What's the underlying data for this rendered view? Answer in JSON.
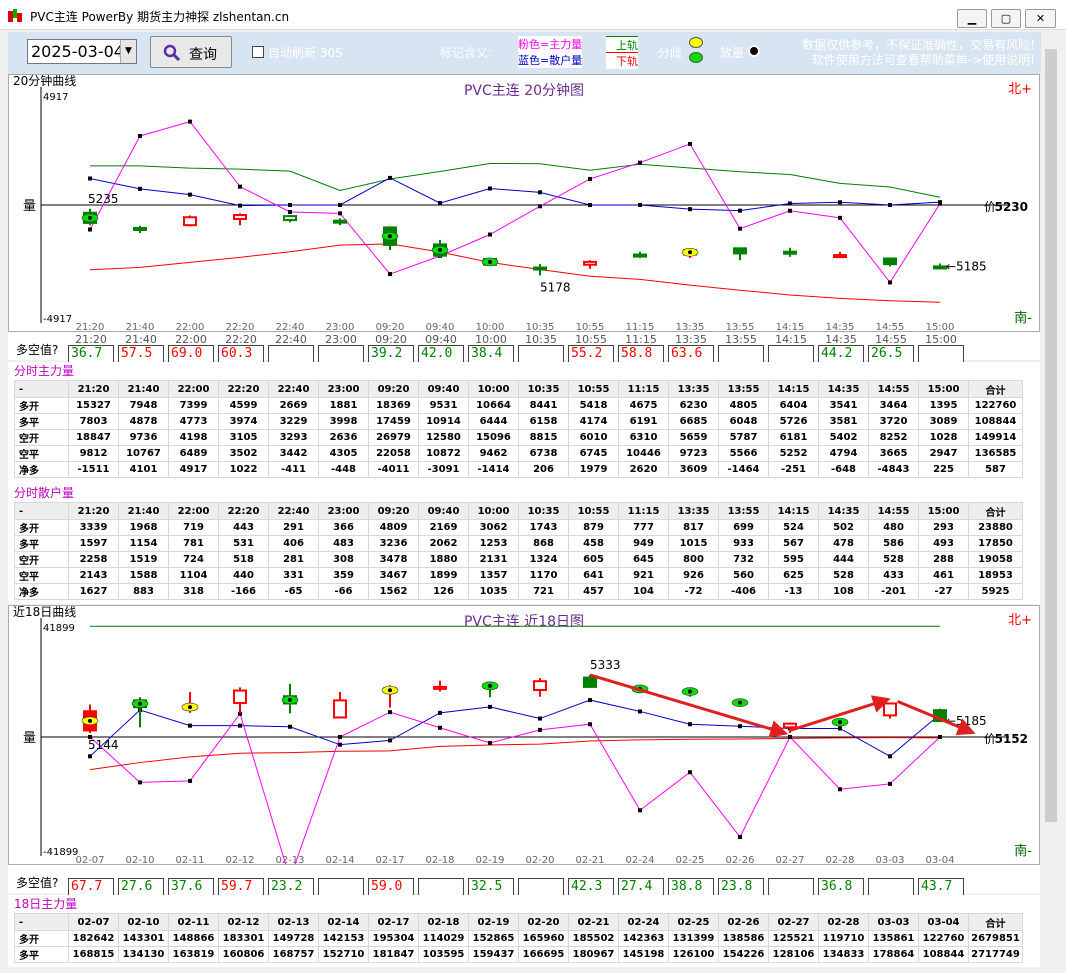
{
  "window": {
    "title": "PVC主连  PowerBy 期货主力神探 zlshentan.cn"
  },
  "toolbar": {
    "date": "2025-03-04",
    "query": "查询",
    "auto_refresh": "自动刷新 30S",
    "legend_title": "标记含义:",
    "legend_pink": "粉色=主力量",
    "legend_blue": "蓝色=散户量",
    "up_rail": "上轨",
    "down_rail": "下轨",
    "diverge": "分歧",
    "volume": "放量",
    "disclaimer1": "数据仅供参考，不保证准确性，交易有风险!",
    "disclaimer2": "软件使用方法可查看帮助菜单->使用说明!"
  },
  "labels": {
    "multi_short": "多空值?"
  },
  "colors": {
    "pink": "#ff00ff",
    "blue": "#0000d0",
    "green": "#008000",
    "red": "#ff0000",
    "up": "#ff0000",
    "down": "#008000"
  },
  "chart_data": [
    {
      "type": "candlestick",
      "section_label": "20分钟曲线",
      "title": "PVC主连 20分钟图",
      "ylabel": "量",
      "top_value": "4917",
      "bottom_value": "-4917",
      "ylim": [
        -4917,
        4917
      ],
      "north": "北+",
      "south": "南-",
      "price_label": "价",
      "price_value": "5230",
      "high_label": "5235",
      "low_label": "5178",
      "last_label": "←5185",
      "categories": [
        "21:20",
        "21:40",
        "22:00",
        "22:20",
        "22:40",
        "23:00",
        "09:20",
        "09:40",
        "10:00",
        "10:35",
        "10:55",
        "11:15",
        "13:35",
        "13:55",
        "14:15",
        "14:35",
        "14:55",
        "15:00"
      ],
      "candles": [
        {
          "o": -0.28,
          "c": 0.08,
          "h": 0.22,
          "l": -0.36,
          "d": "down"
        },
        {
          "o": -0.46,
          "c": -0.46,
          "h": -0.38,
          "l": -0.64,
          "d": "down"
        },
        {
          "o": -0.36,
          "c": -0.08,
          "h": -0.02,
          "l": -0.4,
          "d": "up"
        },
        {
          "o": -0.14,
          "c": 0.0,
          "h": 0.06,
          "l": -0.36,
          "d": "up"
        },
        {
          "o": -0.18,
          "c": -0.04,
          "h": 0.0,
          "l": -0.26,
          "d": "down"
        },
        {
          "o": -0.2,
          "c": -0.24,
          "h": -0.12,
          "l": -0.36,
          "d": "down"
        },
        {
          "o": -0.44,
          "c": -1.06,
          "h": -0.4,
          "l": -1.24,
          "d": "down"
        },
        {
          "o": -1.04,
          "c": -1.44,
          "h": -0.88,
          "l": -1.52,
          "d": "down"
        },
        {
          "o": -1.56,
          "c": -1.76,
          "h": -1.52,
          "l": -1.8,
          "d": "down"
        },
        {
          "o": -1.86,
          "c": -1.86,
          "h": -1.74,
          "l": -2.14,
          "d": "down"
        },
        {
          "o": -1.76,
          "c": -1.66,
          "h": -1.6,
          "l": -1.9,
          "d": "up"
        },
        {
          "o": -1.4,
          "c": -1.4,
          "h": -1.3,
          "l": -1.52,
          "d": "down"
        },
        {
          "o": -1.24,
          "c": -1.4,
          "h": -1.2,
          "l": -1.52,
          "d": "up"
        },
        {
          "o": -1.36,
          "c": -1.18,
          "h": -1.18,
          "l": -1.6,
          "d": "down"
        },
        {
          "o": -1.3,
          "c": -1.36,
          "h": -1.16,
          "l": -1.48,
          "d": "down"
        },
        {
          "o": -1.42,
          "c": -1.42,
          "h": -1.3,
          "l": -1.52,
          "d": "up"
        },
        {
          "o": -1.74,
          "c": -1.54,
          "h": -1.5,
          "l": -1.82,
          "d": "down"
        },
        {
          "o": -1.82,
          "c": -1.82,
          "h": -1.72,
          "l": -1.92,
          "d": "down"
        }
      ],
      "pink": [
        -1022,
        2876,
        3474,
        765,
        -290,
        -348,
        -2879,
        -2124,
        -1230,
        -54,
        1085,
        1763,
        2544,
        -987,
        -241,
        -536,
        -3226,
        59
      ],
      "blue": [
        1105,
        672,
        432,
        -25,
        0,
        0,
        1129,
        80,
        687,
        528,
        0,
        0,
        -174,
        -236,
        62,
        114,
        0,
        118
      ],
      "green": [
        1630,
        1630,
        1536,
        1493,
        1410,
        607,
        1082,
        1395,
        1731,
        1720,
        1447,
        1697,
        1542,
        1386,
        1272,
        901,
        749,
        325
      ],
      "red": [
        -2700,
        -2600,
        -2390,
        -2180,
        -1950,
        -1670,
        -1620,
        -1960,
        -2390,
        -2690,
        -2970,
        -3100,
        -3340,
        -3550,
        -3750,
        -3890,
        -3990,
        -4050
      ],
      "multi_short": [
        "36.7",
        "57.5",
        "69.0",
        "60.3",
        "",
        "",
        "39.2",
        "42.0",
        "38.4",
        "",
        "55.2",
        "58.8",
        "63.6",
        "",
        "",
        "44.2",
        "26.5",
        ""
      ],
      "multi_short_color": [
        "g",
        "r",
        "r",
        "r",
        "",
        "",
        "g",
        "g",
        "g",
        "",
        "r",
        "r",
        "r",
        "",
        "",
        "g",
        "g",
        ""
      ],
      "diverge_marks": [
        0,
        6,
        7,
        8,
        12
      ],
      "volume_marks": [
        6,
        7,
        8
      ]
    },
    {
      "type": "candlestick",
      "section_label": "近18日曲线",
      "title": "PVC主连 近18日图",
      "ylabel": "量",
      "top_value": "41899",
      "bottom_value": "-41899",
      "ylim": [
        -41899,
        41899
      ],
      "north": "北+",
      "south": "南-",
      "price_label": "价",
      "price_value": "5152",
      "high_label": "5333",
      "low_label": "5144",
      "last_label": "←5185",
      "categories": [
        "02-07",
        "02-10",
        "02-11",
        "02-12",
        "02-13",
        "02-14",
        "02-17",
        "02-18",
        "02-19",
        "02-20",
        "02-21",
        "02-24",
        "02-25",
        "02-26",
        "02-27",
        "02-28",
        "03-03",
        "03-04"
      ],
      "candles": [
        {
          "o": 0.1,
          "c": 0.84,
          "h": 1.1,
          "l": 0.0,
          "d": "up"
        },
        {
          "o": 1.0,
          "c": 1.26,
          "h": 1.38,
          "l": 0.22,
          "d": "down"
        },
        {
          "o": 1.0,
          "c": 1.0,
          "h": 1.58,
          "l": 0.78,
          "d": "up"
        },
        {
          "o": 1.16,
          "c": 1.64,
          "h": 1.76,
          "l": 0.76,
          "d": "up"
        },
        {
          "o": 1.42,
          "c": 1.14,
          "h": 1.9,
          "l": 0.76,
          "d": "down"
        },
        {
          "o": 0.6,
          "c": 1.26,
          "h": 1.58,
          "l": 0.6,
          "d": "up"
        },
        {
          "o": 1.58,
          "c": 1.72,
          "h": 1.84,
          "l": 0.98,
          "d": "up"
        },
        {
          "o": 1.78,
          "c": 1.78,
          "h": 2.02,
          "l": 1.6,
          "d": "up"
        },
        {
          "o": 1.82,
          "c": 1.82,
          "h": 1.88,
          "l": 1.38,
          "d": "down"
        },
        {
          "o": 1.66,
          "c": 2.0,
          "h": 2.12,
          "l": 1.4,
          "d": "up"
        },
        {
          "o": 1.78,
          "c": 2.14,
          "h": 2.24,
          "l": 1.78,
          "d": "down"
        },
        {
          "o": 1.7,
          "c": 1.7,
          "h": 1.78,
          "l": 1.54,
          "d": "down"
        },
        {
          "o": 1.54,
          "c": 1.66,
          "h": 1.7,
          "l": 1.4,
          "d": "down"
        },
        {
          "o": 1.2,
          "c": 1.14,
          "h": 1.32,
          "l": 1.04,
          "d": "down"
        },
        {
          "o": 0.22,
          "c": 0.36,
          "h": 0.4,
          "l": 0.0,
          "d": "up"
        },
        {
          "o": 0.4,
          "c": 0.44,
          "h": 0.52,
          "l": 0.36,
          "d": "down"
        },
        {
          "o": 0.68,
          "c": 1.14,
          "h": 1.14,
          "l": 0.56,
          "d": "up"
        },
        {
          "o": 0.46,
          "c": 0.88,
          "h": 0.94,
          "l": 0.42,
          "d": "down"
        }
      ],
      "pink": [
        3,
        -15980,
        -15460,
        8200,
        -49800,
        0,
        8750,
        3250,
        -2100,
        2500,
        4500,
        -25800,
        -12400,
        -35200,
        0,
        -18400,
        -16500,
        0
      ],
      "blue": [
        -6800,
        9500,
        4000,
        4000,
        3600,
        -2700,
        -1200,
        8500,
        10600,
        6500,
        13000,
        9000,
        4500,
        3800,
        3000,
        3000,
        -6800,
        8000
      ],
      "green": [
        39000,
        39000,
        39000,
        39000,
        39000,
        39000,
        39000,
        39000,
        39000,
        39000,
        39000,
        39000,
        39000,
        39000,
        39000,
        39000,
        39000,
        39000
      ],
      "red": [
        -11500,
        -9000,
        -7000,
        -5700,
        -5500,
        -5000,
        -4900,
        -3300,
        -2800,
        -2500,
        -1400,
        -1000,
        -800,
        -700,
        -500,
        -300,
        -200,
        -300
      ],
      "multi_short": [
        "67.7",
        "27.6",
        "37.6",
        "59.7",
        "23.2",
        "",
        "59.0",
        "",
        "32.5",
        "",
        "42.3",
        "27.4",
        "38.8",
        "23.8",
        "",
        "36.8",
        "",
        "43.7"
      ],
      "multi_short_color": [
        "r",
        "g",
        "g",
        "r",
        "g",
        "",
        "r",
        "",
        "g",
        "",
        "g",
        "g",
        "g",
        "g",
        "",
        "g",
        "",
        "g"
      ],
      "diverge_marks": [
        0,
        1,
        2,
        4,
        6,
        8,
        11,
        12,
        13,
        15
      ],
      "volume_marks": []
    }
  ],
  "tables": {
    "main20": {
      "title": "分时主力量",
      "header": [
        "-",
        "21:20",
        "21:40",
        "22:00",
        "22:20",
        "22:40",
        "23:00",
        "09:20",
        "09:40",
        "10:00",
        "10:35",
        "10:55",
        "11:15",
        "13:35",
        "13:55",
        "14:15",
        "14:35",
        "14:55",
        "15:00",
        "合计"
      ],
      "rows": [
        [
          "多开",
          "15327",
          "7948",
          "7399",
          "4599",
          "2669",
          "1881",
          "18369",
          "9531",
          "10664",
          "8441",
          "5418",
          "4675",
          "6230",
          "4805",
          "6404",
          "3541",
          "3464",
          "1395",
          "122760"
        ],
        [
          "多平",
          "7803",
          "4878",
          "4773",
          "3974",
          "3229",
          "3998",
          "17459",
          "10914",
          "6444",
          "6158",
          "4174",
          "6191",
          "6685",
          "6048",
          "5726",
          "3581",
          "3720",
          "3089",
          "108844"
        ],
        [
          "空开",
          "18847",
          "9736",
          "4198",
          "3105",
          "3293",
          "2636",
          "26979",
          "12580",
          "15096",
          "8815",
          "6010",
          "6310",
          "5659",
          "5787",
          "6181",
          "5402",
          "8252",
          "1028",
          "149914"
        ],
        [
          "空平",
          "9812",
          "10767",
          "6489",
          "3502",
          "3442",
          "4305",
          "22058",
          "10872",
          "9462",
          "6738",
          "6745",
          "10446",
          "9723",
          "5566",
          "5252",
          "4794",
          "3665",
          "2947",
          "136585"
        ],
        [
          "净多",
          "-1511",
          "4101",
          "4917",
          "1022",
          "-411",
          "-448",
          "-4011",
          "-3091",
          "-1414",
          "206",
          "1979",
          "2620",
          "3609",
          "-1464",
          "-251",
          "-648",
          "-4843",
          "225",
          "587"
        ]
      ]
    },
    "retail20": {
      "title": "分时散户量",
      "header": [
        "-",
        "21:20",
        "21:40",
        "22:00",
        "22:20",
        "22:40",
        "23:00",
        "09:20",
        "09:40",
        "10:00",
        "10:35",
        "10:55",
        "11:15",
        "13:35",
        "13:55",
        "14:15",
        "14:35",
        "14:55",
        "15:00",
        "合计"
      ],
      "rows": [
        [
          "多开",
          "3339",
          "1968",
          "719",
          "443",
          "291",
          "366",
          "4809",
          "2169",
          "3062",
          "1743",
          "879",
          "777",
          "817",
          "699",
          "524",
          "502",
          "480",
          "293",
          "23880"
        ],
        [
          "多平",
          "1597",
          "1154",
          "781",
          "531",
          "406",
          "483",
          "3236",
          "2062",
          "1253",
          "868",
          "458",
          "949",
          "1015",
          "933",
          "567",
          "478",
          "586",
          "493",
          "17850"
        ],
        [
          "空开",
          "2258",
          "1519",
          "724",
          "518",
          "281",
          "308",
          "3478",
          "1880",
          "2131",
          "1324",
          "605",
          "645",
          "800",
          "732",
          "595",
          "444",
          "528",
          "288",
          "19058"
        ],
        [
          "空平",
          "2143",
          "1588",
          "1104",
          "440",
          "331",
          "359",
          "3467",
          "1899",
          "1357",
          "1170",
          "641",
          "921",
          "926",
          "560",
          "625",
          "528",
          "433",
          "461",
          "18953"
        ],
        [
          "净多",
          "1627",
          "883",
          "318",
          "-166",
          "-65",
          "-66",
          "1562",
          "126",
          "1035",
          "721",
          "457",
          "104",
          "-72",
          "-406",
          "-13",
          "108",
          "-201",
          "-27",
          "5925"
        ]
      ]
    },
    "main18": {
      "title": "18日主力量",
      "header": [
        "-",
        "02-07",
        "02-10",
        "02-11",
        "02-12",
        "02-13",
        "02-14",
        "02-17",
        "02-18",
        "02-19",
        "02-20",
        "02-21",
        "02-24",
        "02-25",
        "02-26",
        "02-27",
        "02-28",
        "03-03",
        "03-04",
        "合计"
      ],
      "rows": [
        [
          "多开",
          "182642",
          "143301",
          "148866",
          "183301",
          "149728",
          "142153",
          "195304",
          "114029",
          "152865",
          "165960",
          "185502",
          "142363",
          "131399",
          "138586",
          "125521",
          "119710",
          "135861",
          "122760",
          "2679851"
        ],
        [
          "多平",
          "168815",
          "134130",
          "163819",
          "160806",
          "168757",
          "152710",
          "181847",
          "103595",
          "159437",
          "166695",
          "180967",
          "145198",
          "126100",
          "154226",
          "128106",
          "134833",
          "178864",
          "108844",
          "2717749"
        ]
      ]
    }
  }
}
